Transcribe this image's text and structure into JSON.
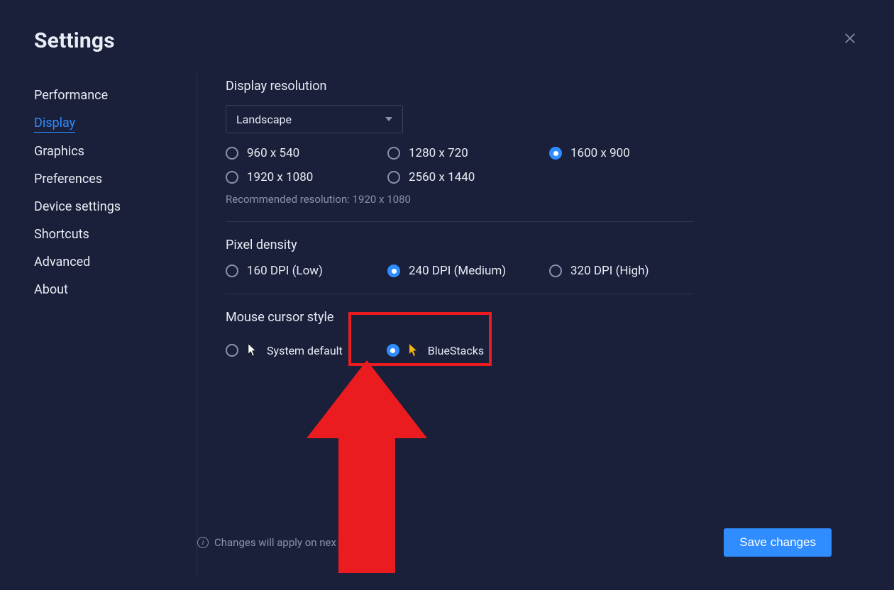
{
  "title": "Settings",
  "sidebar": {
    "items": [
      {
        "label": "Performance",
        "active": false
      },
      {
        "label": "Display",
        "active": true
      },
      {
        "label": "Graphics",
        "active": false
      },
      {
        "label": "Preferences",
        "active": false
      },
      {
        "label": "Device settings",
        "active": false
      },
      {
        "label": "Shortcuts",
        "active": false
      },
      {
        "label": "Advanced",
        "active": false
      },
      {
        "label": "About",
        "active": false
      }
    ]
  },
  "display": {
    "resolution_title": "Display resolution",
    "orientation_selected": "Landscape",
    "resolutions": [
      {
        "label": "960 x 540",
        "selected": false
      },
      {
        "label": "1280 x 720",
        "selected": false
      },
      {
        "label": "1600 x 900",
        "selected": true
      },
      {
        "label": "1920 x 1080",
        "selected": false
      },
      {
        "label": "2560 x 1440",
        "selected": false
      }
    ],
    "recommended_text": "Recommended resolution: 1920 x 1080",
    "pixel_density_title": "Pixel density",
    "dpi_options": [
      {
        "label": "160 DPI (Low)",
        "selected": false
      },
      {
        "label": "240 DPI (Medium)",
        "selected": true
      },
      {
        "label": "320 DPI (High)",
        "selected": false
      }
    ],
    "cursor_title": "Mouse cursor style",
    "cursor_options": [
      {
        "label": "System default",
        "selected": false
      },
      {
        "label": "BlueStacks",
        "selected": true
      }
    ]
  },
  "footer": {
    "info_text": "Changes will apply on nex",
    "save_label": "Save changes"
  },
  "annotation": {
    "highlight_target": "cursor-option-bluestacks",
    "arrow_direction": "up",
    "arrow_color": "#ea1c1f"
  }
}
